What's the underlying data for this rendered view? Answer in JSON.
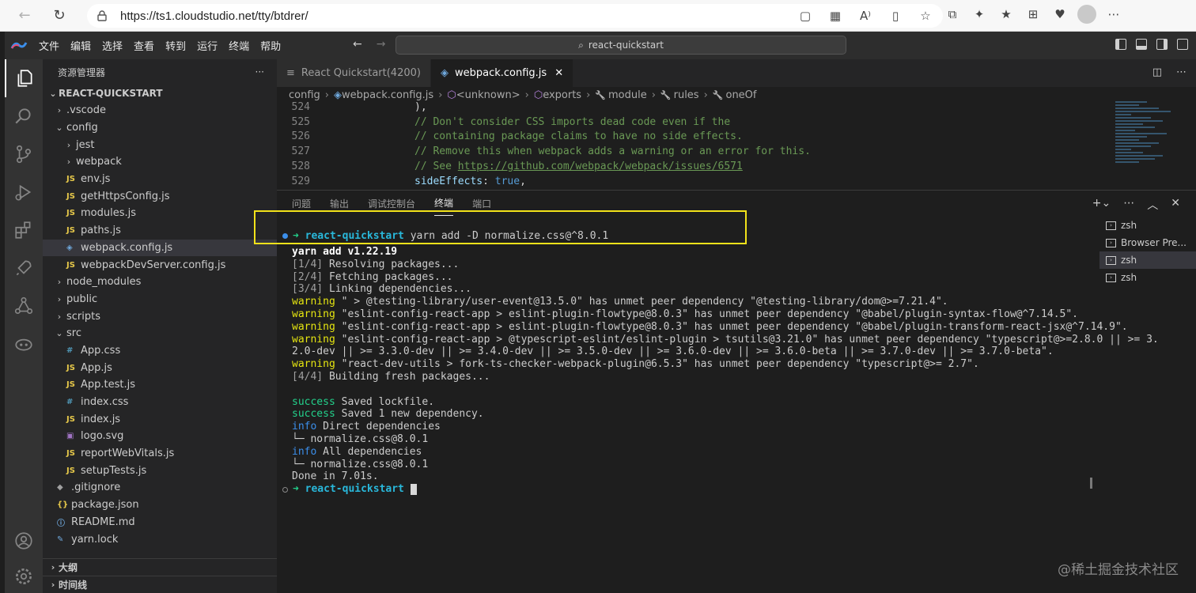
{
  "browser": {
    "url": "https://ts1.cloudstudio.net/tty/btdrer/"
  },
  "menu": [
    "文件",
    "编辑",
    "选择",
    "查看",
    "转到",
    "运行",
    "终端",
    "帮助"
  ],
  "command_center": "react-quickstart",
  "explorer": {
    "title": "资源管理器",
    "more": "···",
    "root": "REACT-QUICKSTART",
    "items": [
      {
        "label": ".vscode",
        "type": "folder",
        "indent": 1,
        "open": false
      },
      {
        "label": "config",
        "type": "folder",
        "indent": 1,
        "open": true
      },
      {
        "label": "jest",
        "type": "folder",
        "indent": 2,
        "open": false
      },
      {
        "label": "webpack",
        "type": "folder",
        "indent": 2,
        "open": false
      },
      {
        "label": "env.js",
        "type": "js",
        "indent": 2
      },
      {
        "label": "getHttpsConfig.js",
        "type": "js",
        "indent": 2
      },
      {
        "label": "modules.js",
        "type": "js",
        "indent": 2
      },
      {
        "label": "paths.js",
        "type": "js",
        "indent": 2
      },
      {
        "label": "webpack.config.js",
        "type": "webpack",
        "indent": 2,
        "selected": true
      },
      {
        "label": "webpackDevServer.config.js",
        "type": "js",
        "indent": 2
      },
      {
        "label": "node_modules",
        "type": "folder",
        "indent": 1,
        "open": false
      },
      {
        "label": "public",
        "type": "folder",
        "indent": 1,
        "open": false
      },
      {
        "label": "scripts",
        "type": "folder",
        "indent": 1,
        "open": false
      },
      {
        "label": "src",
        "type": "folder",
        "indent": 1,
        "open": true
      },
      {
        "label": "App.css",
        "type": "css",
        "indent": 2
      },
      {
        "label": "App.js",
        "type": "js",
        "indent": 2
      },
      {
        "label": "App.test.js",
        "type": "js",
        "indent": 2
      },
      {
        "label": "index.css",
        "type": "css",
        "indent": 2
      },
      {
        "label": "index.js",
        "type": "js",
        "indent": 2
      },
      {
        "label": "logo.svg",
        "type": "svg",
        "indent": 2
      },
      {
        "label": "reportWebVitals.js",
        "type": "js",
        "indent": 2
      },
      {
        "label": "setupTests.js",
        "type": "js",
        "indent": 2
      },
      {
        "label": ".gitignore",
        "type": "git",
        "indent": 1
      },
      {
        "label": "package.json",
        "type": "json",
        "indent": 1
      },
      {
        "label": "README.md",
        "type": "info",
        "indent": 1
      },
      {
        "label": "yarn.lock",
        "type": "yarn",
        "indent": 1
      }
    ],
    "outline": "大纲",
    "timeline": "时间线"
  },
  "icon_glyphs": {
    "js": "JS",
    "css": "#",
    "webpack": "◈",
    "svg": "▣",
    "git": "◆",
    "json": "{}",
    "info": "ⓘ",
    "yarn": "✎"
  },
  "tabs": [
    {
      "label": "React Quickstart(4200)",
      "active": false
    },
    {
      "label": "webpack.config.js",
      "active": true,
      "close": "✕"
    }
  ],
  "breadcrumb": [
    "config",
    "webpack.config.js",
    "<unknown>",
    "exports",
    "module",
    "rules",
    "oneOf"
  ],
  "code_lines": [
    {
      "num": "524",
      "parts": [
        {
          "t": "),",
          "c": "punc"
        }
      ]
    },
    {
      "num": "525",
      "parts": [
        {
          "t": "// Don't consider CSS imports dead code even if the",
          "c": "cmt"
        }
      ]
    },
    {
      "num": "526",
      "parts": [
        {
          "t": "// containing package claims to have no side effects.",
          "c": "cmt"
        }
      ]
    },
    {
      "num": "527",
      "parts": [
        {
          "t": "// Remove this when webpack adds a warning or an error for this.",
          "c": "cmt"
        }
      ]
    },
    {
      "num": "528",
      "parts": [
        {
          "t": "// See ",
          "c": "cmt"
        },
        {
          "t": "https://github.com/webpack/webpack/issues/6571",
          "c": "link"
        }
      ]
    },
    {
      "num": "529",
      "parts": [
        {
          "t": "sideEffects",
          "c": "key"
        },
        {
          "t": ": ",
          "c": "punc"
        },
        {
          "t": "true",
          "c": "kw"
        },
        {
          "t": ",",
          "c": "punc"
        }
      ]
    }
  ],
  "panel": {
    "tabs": [
      "问题",
      "输出",
      "调试控制台",
      "终端",
      "端口"
    ],
    "active_tab": "终端"
  },
  "terminal": {
    "prompt_arrow": "➜",
    "prompt_dir": "react-quickstart",
    "command": " yarn add -D normalize.css@^8.0.1",
    "lines": [
      [
        {
          "t": "yarn add v1.22.19",
          "c": "bold"
        }
      ],
      [
        {
          "t": "[1/4]",
          "c": "dimc"
        },
        {
          "t": " Resolving packages...",
          "c": ""
        }
      ],
      [
        {
          "t": "[2/4]",
          "c": "dimc"
        },
        {
          "t": " Fetching packages...",
          "c": ""
        }
      ],
      [
        {
          "t": "[3/4]",
          "c": "dimc"
        },
        {
          "t": " Linking dependencies...",
          "c": ""
        }
      ],
      [
        {
          "t": "warning",
          "c": "warn"
        },
        {
          "t": " \" > @testing-library/user-event@13.5.0\" has unmet peer dependency \"@testing-library/dom@>=7.21.4\".",
          "c": ""
        }
      ],
      [
        {
          "t": "warning",
          "c": "warn"
        },
        {
          "t": " \"eslint-config-react-app > eslint-plugin-flowtype@8.0.3\" has unmet peer dependency \"@babel/plugin-syntax-flow@^7.14.5\".",
          "c": ""
        }
      ],
      [
        {
          "t": "warning",
          "c": "warn"
        },
        {
          "t": " \"eslint-config-react-app > eslint-plugin-flowtype@8.0.3\" has unmet peer dependency \"@babel/plugin-transform-react-jsx@^7.14.9\".",
          "c": ""
        }
      ],
      [
        {
          "t": "warning",
          "c": "warn"
        },
        {
          "t": " \"eslint-config-react-app > @typescript-eslint/eslint-plugin > tsutils@3.21.0\" has unmet peer dependency \"typescript@>=2.8.0 || >= 3.",
          "c": ""
        }
      ],
      [
        {
          "t": "2.0-dev || >= 3.3.0-dev || >= 3.4.0-dev || >= 3.5.0-dev || >= 3.6.0-dev || >= 3.6.0-beta || >= 3.7.0-dev || >= 3.7.0-beta\".",
          "c": ""
        }
      ],
      [
        {
          "t": "warning",
          "c": "warn"
        },
        {
          "t": " \"react-dev-utils > fork-ts-checker-webpack-plugin@6.5.3\" has unmet peer dependency \"typescript@>= 2.7\".",
          "c": ""
        }
      ],
      [
        {
          "t": "[4/4]",
          "c": "dimc"
        },
        {
          "t": " Building fresh packages...",
          "c": ""
        }
      ],
      [
        {
          "t": "",
          "c": ""
        }
      ],
      [
        {
          "t": "success",
          "c": "succ"
        },
        {
          "t": " Saved lockfile.",
          "c": ""
        }
      ],
      [
        {
          "t": "success",
          "c": "succ"
        },
        {
          "t": " Saved 1 new dependency.",
          "c": ""
        }
      ],
      [
        {
          "t": "info",
          "c": "infoc"
        },
        {
          "t": " Direct dependencies",
          "c": ""
        }
      ],
      [
        {
          "t": "└─ normalize.css@8.0.1",
          "c": ""
        }
      ],
      [
        {
          "t": "info",
          "c": "infoc"
        },
        {
          "t": " All dependencies",
          "c": ""
        }
      ],
      [
        {
          "t": "└─ normalize.css@8.0.1",
          "c": ""
        }
      ],
      [
        {
          "t": "Done in 7.01s.",
          "c": ""
        }
      ]
    ],
    "list": [
      {
        "label": "zsh",
        "selected": false
      },
      {
        "label": "Browser Pre...",
        "selected": false
      },
      {
        "label": "zsh",
        "selected": true
      },
      {
        "label": "zsh",
        "selected": false
      }
    ]
  },
  "watermark": "@稀土掘金技术社区",
  "colors": {
    "highlight": "#f2e21a",
    "accent": "#3b8eea"
  }
}
